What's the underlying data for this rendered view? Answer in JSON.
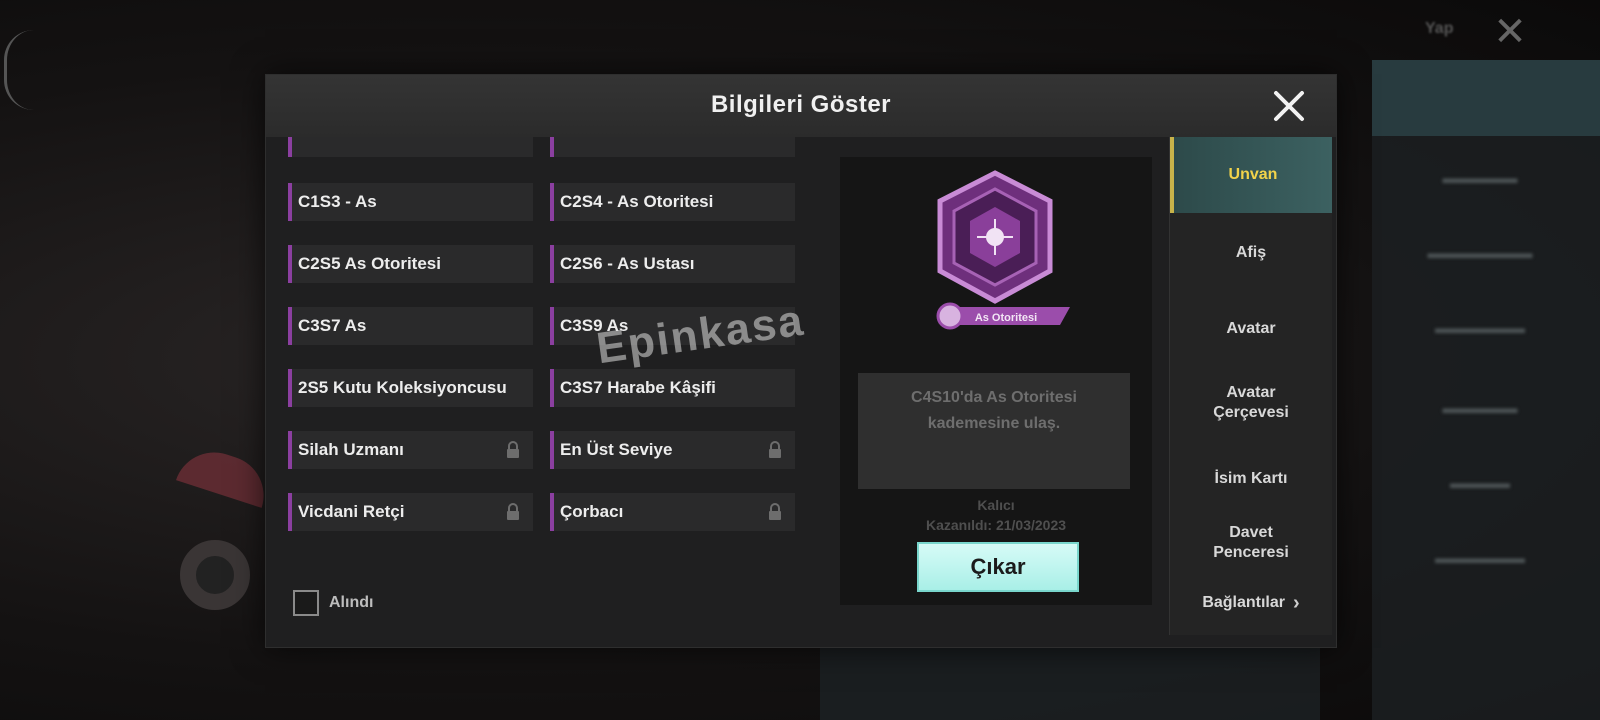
{
  "modal": {
    "title": "Bilgileri Göster",
    "close_icon": "close-icon"
  },
  "titles": [
    {
      "label": "",
      "locked": false
    },
    {
      "label": "",
      "locked": false
    },
    {
      "label": "C1S3 - As",
      "locked": false
    },
    {
      "label": "C2S4 - As Otoritesi",
      "locked": false
    },
    {
      "label": "C2S5 As Otoritesi",
      "locked": false
    },
    {
      "label": "C2S6 - As Ustası",
      "locked": false
    },
    {
      "label": "C3S7 As",
      "locked": false
    },
    {
      "label": "C3S9 As",
      "locked": false
    },
    {
      "label": "2S5 Kutu Koleksiyoncusu",
      "locked": false
    },
    {
      "label": "C3S7 Harabe Kâşifi",
      "locked": false
    },
    {
      "label": "Silah Uzmanı",
      "locked": true
    },
    {
      "label": "En Üst Seviye",
      "locked": true
    },
    {
      "label": "Vicdani Retçi",
      "locked": true
    },
    {
      "label": "Çorbacı",
      "locked": true
    }
  ],
  "filter": {
    "obtained_label": "Alındı",
    "checked": false
  },
  "preview": {
    "badge_label": "As Otoritesi",
    "badge_color": "#9b4dab",
    "description": "C4S10'da As Otoritesi kademesine ulaş.",
    "status_line1": "Kalıcı",
    "status_line2": "Kazanıldı: 21/03/2023",
    "action_label": "Çıkar"
  },
  "tabs": [
    {
      "label": "Unvan",
      "active": true
    },
    {
      "label": "Afiş",
      "active": false
    },
    {
      "label": "Avatar",
      "active": false
    },
    {
      "label": "Avatar Çerçevesi",
      "active": false
    },
    {
      "label": "İsim Kartı",
      "active": false
    },
    {
      "label": "Davet Penceresi",
      "active": false
    },
    {
      "label": "Bağlantılar",
      "active": false
    }
  ],
  "watermark": "Epinkasa",
  "background": {
    "top_label": "Yap"
  }
}
